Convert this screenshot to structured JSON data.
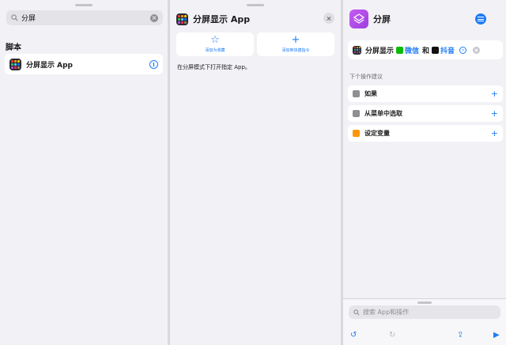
{
  "left": {
    "search_value": "分屏",
    "section_title": "脚本",
    "script_item": {
      "label": "分屏显示 App"
    }
  },
  "middle": {
    "title": "分屏显示 App",
    "actions": [
      {
        "label": "添加为收藏",
        "icon": "star-icon"
      },
      {
        "label": "添加到快捷指令",
        "icon": "plus-icon"
      }
    ],
    "description": "在分屏模式下打开指定 App。"
  },
  "right": {
    "title": "分屏",
    "action": {
      "verb": "分屏显示",
      "app1": "微信",
      "conjunction": "和",
      "app2": "抖音"
    },
    "suggestions_title": "下个操作建议",
    "suggestions": [
      {
        "label": "如果",
        "color": "#8e8e93"
      },
      {
        "label": "从菜单中选取",
        "color": "#8e8e93"
      },
      {
        "label": "设定变量",
        "color": "#ff9500"
      }
    ],
    "search_placeholder": "搜索 App和操作"
  },
  "colors": {
    "accent": "#1f7cf5",
    "shortcut_gradient": "#c85bf0",
    "wechat": "#09bb07",
    "douyin": "#111111"
  }
}
